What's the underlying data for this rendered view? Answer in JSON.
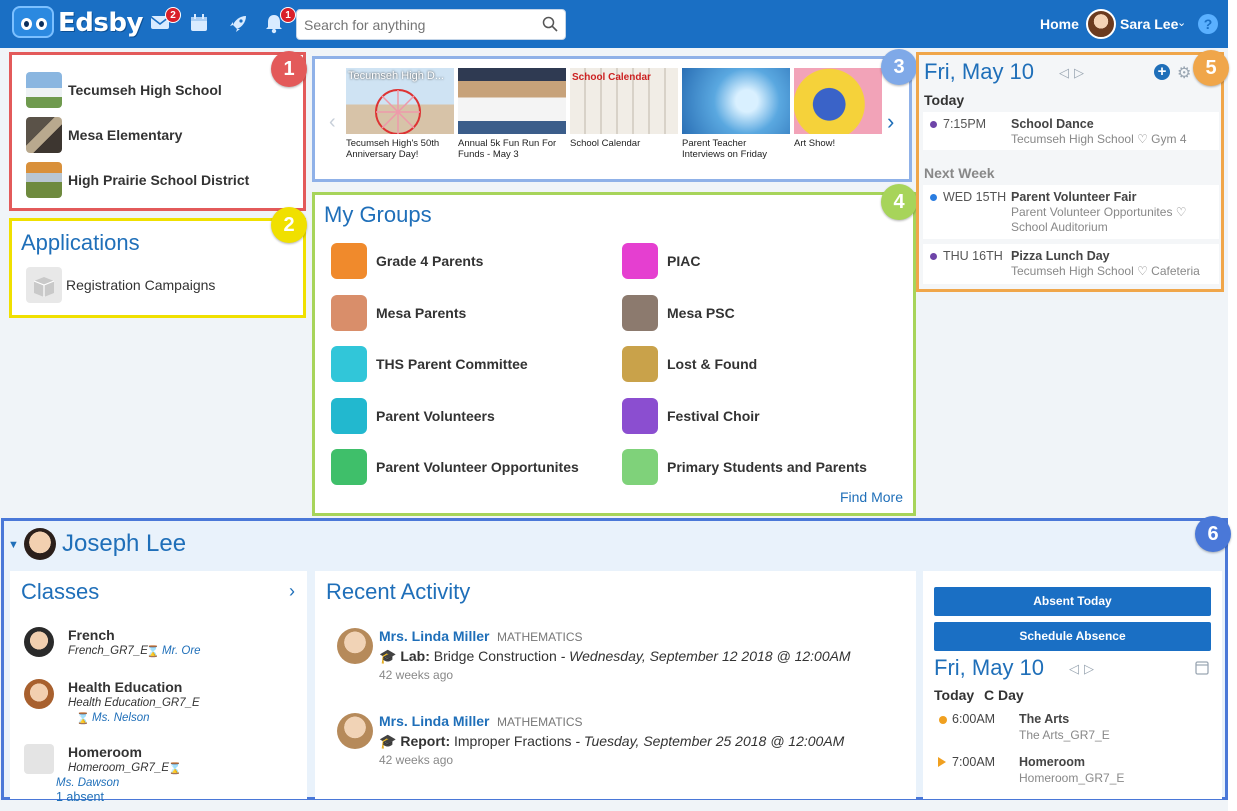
{
  "topbar": {
    "logo_text": "Edsby",
    "mail_badge": "2",
    "notif_badge": "1",
    "search_placeholder": "Search for anything",
    "home_label": "Home",
    "user_name": "Sara Lee",
    "help_label": "?"
  },
  "callouts": [
    "1",
    "2",
    "3",
    "4",
    "5",
    "6"
  ],
  "schools": [
    {
      "name": "Tecumseh High School"
    },
    {
      "name": "Mesa Elementary"
    },
    {
      "name": "High Prairie School District"
    }
  ],
  "applications": {
    "title": "Applications",
    "items": [
      {
        "label": "Registration Campaigns"
      }
    ]
  },
  "news": [
    {
      "caption": "Tecumseh High's 50th Anniversary Day!",
      "img_text": "Tecumseh High D..."
    },
    {
      "caption": "Annual 5k Fun Run For Funds - May 3",
      "img_text": ""
    },
    {
      "caption": "School Calendar",
      "img_text": "School Calendar"
    },
    {
      "caption": "Parent Teacher Interviews on Friday",
      "img_text": ""
    },
    {
      "caption": "Art Show!",
      "img_text": ""
    }
  ],
  "groups": {
    "title": "My Groups",
    "find_more": "Find More",
    "items": [
      {
        "name": "Grade 4 Parents",
        "color": "#f08a2c"
      },
      {
        "name": "PIAC",
        "color": "#e53fd0"
      },
      {
        "name": "Mesa Parents",
        "color": "#d98e6a"
      },
      {
        "name": "Mesa PSC",
        "color": "#8c7a6e"
      },
      {
        "name": "THS Parent Committee",
        "color": "#31c6d9"
      },
      {
        "name": "Lost & Found",
        "color": "#c9a24a"
      },
      {
        "name": "Parent Volunteers",
        "color": "#22b8cf"
      },
      {
        "name": "Festival Choir",
        "color": "#8b4ed0"
      },
      {
        "name": "Parent Volunteer Opportunites",
        "color": "#3fbf6a"
      },
      {
        "name": "Primary Students and Parents",
        "color": "#7fd27a"
      }
    ]
  },
  "calendar": {
    "date": "Fri, May 10",
    "today_label": "Today",
    "next_week_label": "Next Week",
    "today_events": [
      {
        "time": "7:15PM",
        "title": "School Dance",
        "location": "Tecumseh High School ♡ Gym 4",
        "dot": "#6e44a8"
      }
    ],
    "next_week_events": [
      {
        "time": "WED 15TH",
        "title": "Parent Volunteer Fair",
        "location": "Parent Volunteer Opportunites ♡ School Auditorium",
        "dot": "#2a7de1"
      },
      {
        "time": "THU 16TH",
        "title": "Pizza Lunch Day",
        "location": "Tecumseh High School ♡ Cafeteria",
        "dot": "#6e44a8"
      }
    ]
  },
  "child": {
    "name": "Joseph Lee",
    "classes_title": "Classes",
    "classes": [
      {
        "name": "French",
        "code": "French_GR7_E",
        "teacher": "Mr. Ore",
        "extra": ""
      },
      {
        "name": "Health Education",
        "code": "Health Education_GR7_E",
        "teacher": "Ms. Nelson",
        "extra": ""
      },
      {
        "name": "Homeroom",
        "code": "Homeroom_GR7_E",
        "teacher": "Ms. Dawson",
        "extra": "1 absent"
      }
    ],
    "activity_title": "Recent Activity",
    "activity": [
      {
        "who": "Mrs. Linda Miller",
        "subject": "MATHEMATICS",
        "kind": "Lab:",
        "text": "Bridge Construction",
        "due": "- Wednesday, September 12 2018 @ 12:00AM",
        "ago": "42 weeks ago"
      },
      {
        "who": "Mrs. Linda Miller",
        "subject": "MATHEMATICS",
        "kind": "Report:",
        "text": "Improper Fractions",
        "due": "- Tuesday, September 25 2018 @ 12:00AM",
        "ago": "42 weeks ago"
      }
    ],
    "absent_today": "Absent Today",
    "schedule_absence": "Schedule Absence",
    "sched_date": "Fri, May 10",
    "sched_today": "Today",
    "sched_day": "C Day",
    "schedule": [
      {
        "time": "6:00AM",
        "title": "The Arts",
        "code": "The Arts_GR7_E",
        "color": "#f0a020"
      },
      {
        "time": "7:00AM",
        "title": "Homeroom",
        "code": "Homeroom_GR7_E",
        "color": "#f0a020"
      }
    ]
  },
  "colors": {
    "brand": "#1a6fc4",
    "callout_1": "#e35a5a",
    "callout_2": "#f0e000",
    "callout_3": "#8fb1e8",
    "callout_4": "#a7d45a",
    "callout_5": "#f0a64a",
    "callout_6": "#4a78d8"
  }
}
